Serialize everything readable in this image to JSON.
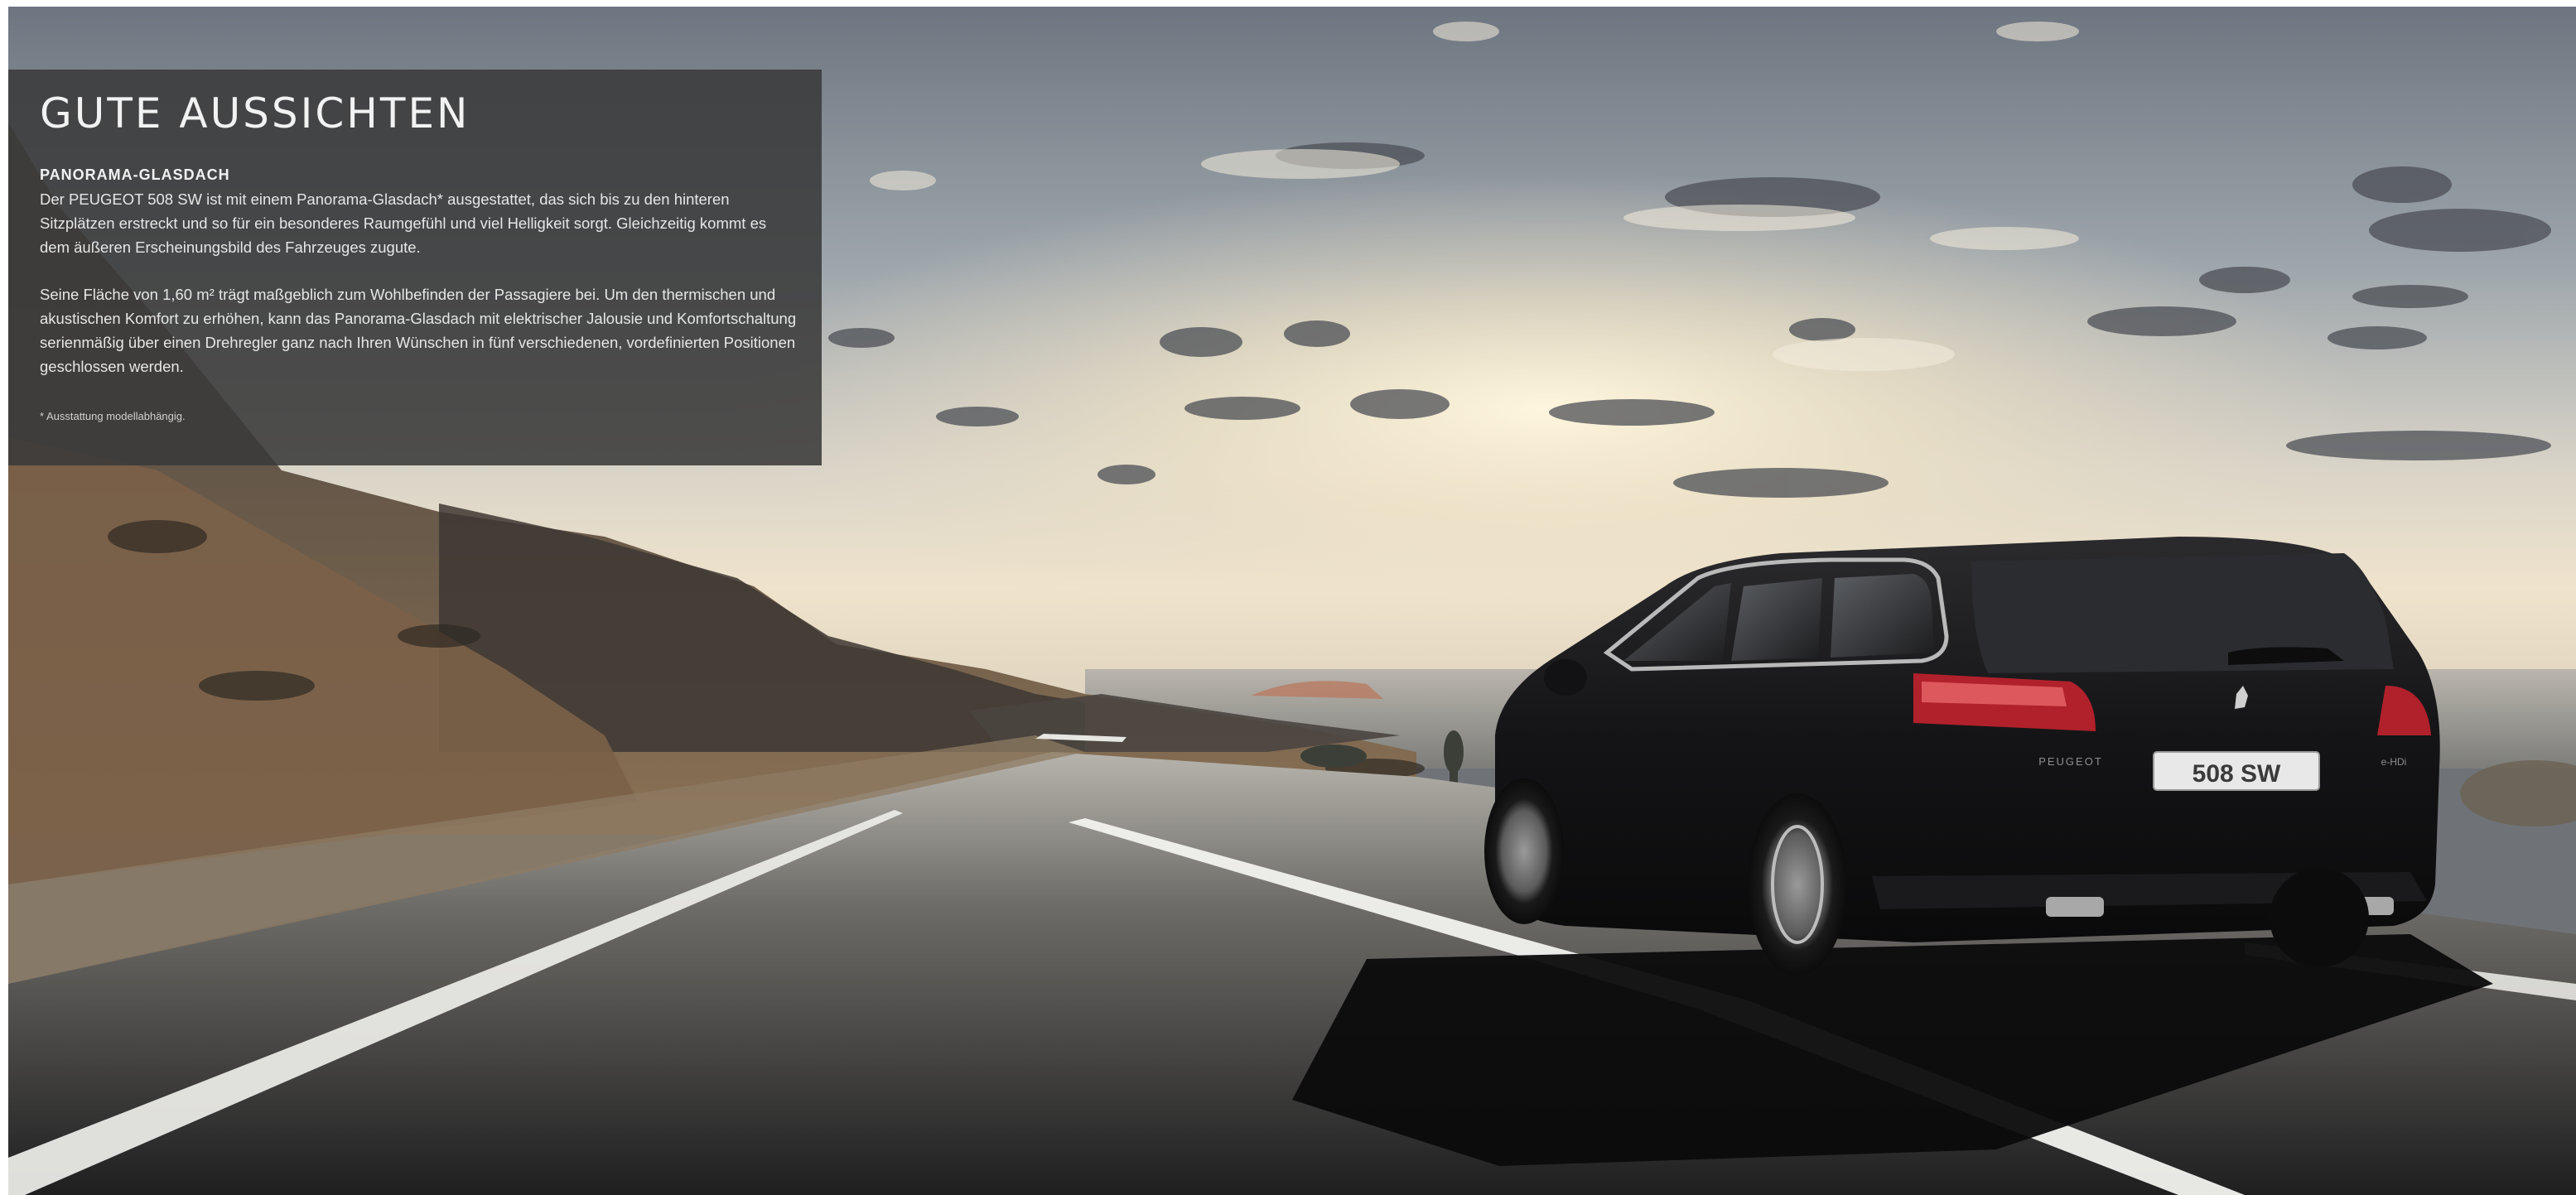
{
  "panel": {
    "headline": "GUTE AUSSICHTEN",
    "subheadline": "PANORAMA-GLASDACH",
    "paragraph_1": "Der PEUGEOT 508 SW ist mit einem Panorama-Glasdach* ausgestattet, das sich bis zu den hinteren Sitzplätzen erstreckt und so für ein besonderes Raumgefühl und viel Helligkeit sorgt. Gleichzeitig kommt es dem äußeren Erscheinungsbild des Fahrzeuges zugute.",
    "paragraph_2": "Seine Fläche von 1,60 m² trägt maßgeblich zum Wohlbefinden der Passagiere bei. Um den thermischen und akustischen Komfort zu erhöhen, kann das Panorama-Glasdach mit elektrischer Jalousie und Komfortschaltung serienmäßig über einen Drehregler ganz nach Ihren Wünschen in fünf verschiedenen, vordefinierten Positionen geschlossen werden.",
    "footnote": "* Ausstattung modellabhängig."
  },
  "car": {
    "plate": "508 SW",
    "tailgate_brand": "PEUGEOT",
    "badge": "e-HDi"
  }
}
